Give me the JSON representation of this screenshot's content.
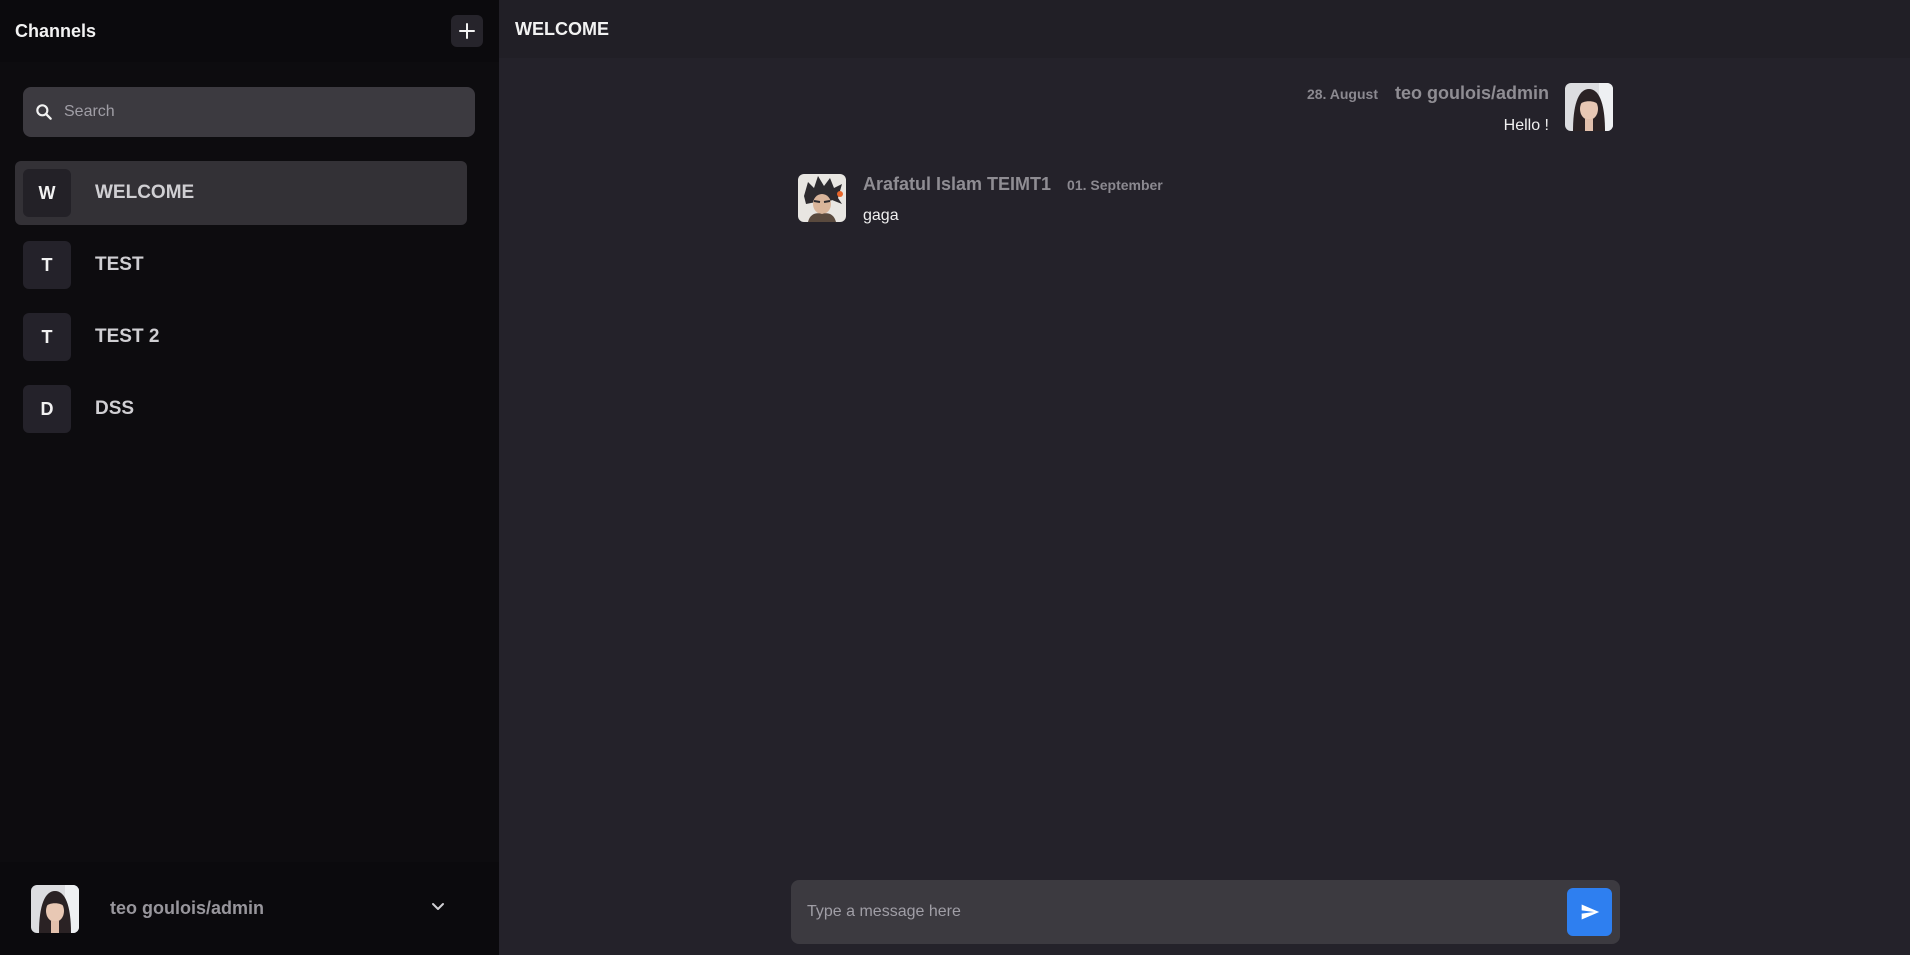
{
  "sidebar": {
    "title": "Channels",
    "add_icon": "plus-icon",
    "search_placeholder": "Search",
    "search_value": "",
    "channels": [
      {
        "initial": "W",
        "name": "WELCOME",
        "active": true
      },
      {
        "initial": "T",
        "name": "TEST",
        "active": false
      },
      {
        "initial": "T",
        "name": "TEST 2",
        "active": false
      },
      {
        "initial": "D",
        "name": "DSS",
        "active": false
      }
    ],
    "user": {
      "name": "teo goulois/admin",
      "menu_icon": "chevron-down-icon"
    }
  },
  "main": {
    "title": "WELCOME",
    "messages": [
      {
        "author": "teo goulois/admin",
        "date": "28. August",
        "text": "Hello !"
      },
      {
        "author": "Arafatul Islam TEIMT1",
        "date": "01. September",
        "text": "gaga"
      }
    ],
    "composer": {
      "placeholder": "Type a message here",
      "value": "",
      "send_icon": "send-icon"
    }
  },
  "colors": {
    "accent": "#2e7ff0",
    "sidebar_bg": "#0d0c0f",
    "main_bg": "#24222a",
    "active_channel": "#333136"
  }
}
